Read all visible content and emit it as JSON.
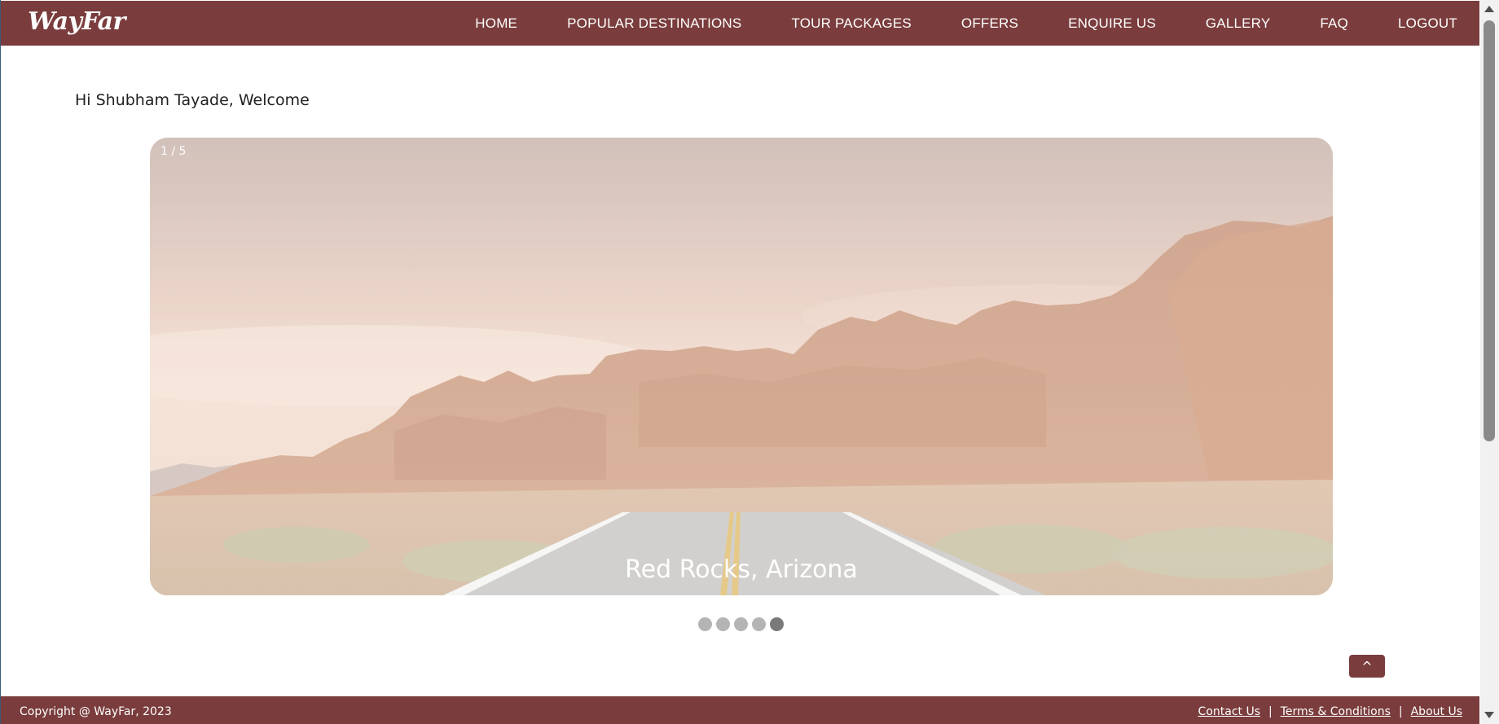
{
  "brand": {
    "name": "WayFar"
  },
  "nav": {
    "items": [
      {
        "label": "HOME"
      },
      {
        "label": "POPULAR DESTINATIONS"
      },
      {
        "label": "TOUR PACKAGES"
      },
      {
        "label": "OFFERS"
      },
      {
        "label": "ENQUIRE US"
      },
      {
        "label": "GALLERY"
      },
      {
        "label": "FAQ"
      },
      {
        "label": "LOGOUT"
      }
    ]
  },
  "welcome": {
    "text": "Hi Shubham Tayade, Welcome"
  },
  "carousel": {
    "counter": "1 / 5",
    "caption": "Red Rocks, Arizona",
    "slide_count": 5,
    "active_dot_index": 4
  },
  "back_to_top": {
    "label": "^"
  },
  "footer": {
    "copyright": "Copyright @ WayFar, 2023",
    "links": [
      {
        "label": "Contact Us"
      },
      {
        "label": "Terms & Conditions"
      },
      {
        "label": "About Us"
      }
    ],
    "separator": "|"
  },
  "colors": {
    "brand": "#7a3c3c",
    "dot_inactive": "#b4b4b4",
    "dot_active": "#7a7a7a"
  }
}
